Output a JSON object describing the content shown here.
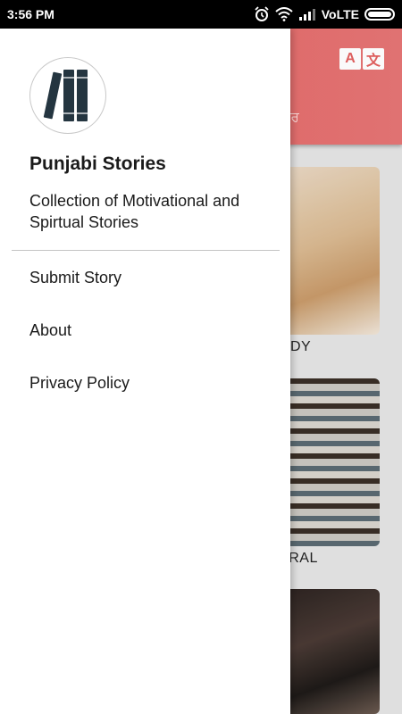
{
  "status_bar": {
    "time": "3:56 PM",
    "network": "VoLTE",
    "icons": [
      "alarm-icon",
      "wifi-icon",
      "signal-icon",
      "battery-icon"
    ]
  },
  "app": {
    "translate_glyphs": [
      "A",
      "文"
    ],
    "header_tab": "ਲਪੇਪਰ",
    "cards": [
      {
        "label": "MEDY"
      },
      {
        "label": "NERAL"
      },
      {
        "label": ""
      }
    ],
    "colors": {
      "header": "#e2605f"
    }
  },
  "drawer": {
    "logo_icon": "books-icon",
    "title": "Punjabi Stories",
    "subtitle": "Collection of Motivational and Spirtual Stories",
    "menu": [
      {
        "label": "Submit Story"
      },
      {
        "label": "About"
      },
      {
        "label": "Privacy Policy"
      }
    ]
  }
}
